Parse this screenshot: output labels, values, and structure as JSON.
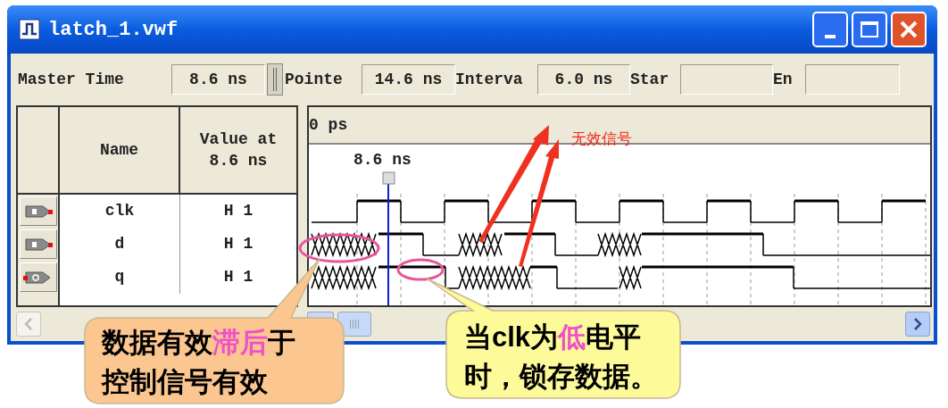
{
  "window": {
    "title": "latch_1.vwf"
  },
  "toolbar": [
    {
      "label": "Master Time",
      "value": "8.6 ns"
    },
    {
      "label": "Pointe",
      "value": "14.6 ns"
    },
    {
      "label": "Interva",
      "value": "6.0 ns"
    },
    {
      "label": "Star"
    },
    {
      "label": "En"
    }
  ],
  "table": {
    "columns": [
      "Name",
      "Value at 8.6 ns"
    ],
    "rows": [
      {
        "kind": "input",
        "name": "clk",
        "value": "H 1"
      },
      {
        "kind": "input",
        "name": "d",
        "value": "H 1"
      },
      {
        "kind": "output",
        "name": "q",
        "value": "H 1"
      }
    ]
  },
  "waveform": {
    "start_time": "0 ps",
    "cursor_time": "8.6 ns"
  },
  "annotations": {
    "label": "无效信号",
    "callouts": [
      {
        "color": "#fbc690",
        "lines": [
          [
            {
              "text": "数据有效",
              "highlight": false
            },
            {
              "text": "滞后",
              "highlight": true
            },
            {
              "text": "于",
              "highlight": false
            }
          ],
          [
            {
              "text": "控制信号有效",
              "highlight": false
            }
          ]
        ]
      },
      {
        "color": "#fdfa9a",
        "lines": [
          [
            {
              "text": "当clk为",
              "highlight": false
            },
            {
              "text": "低",
              "highlight": true
            },
            {
              "text": "电平",
              "highlight": false
            }
          ],
          [
            {
              "text": "时，锁存数据。",
              "highlight": false
            }
          ]
        ]
      }
    ]
  }
}
